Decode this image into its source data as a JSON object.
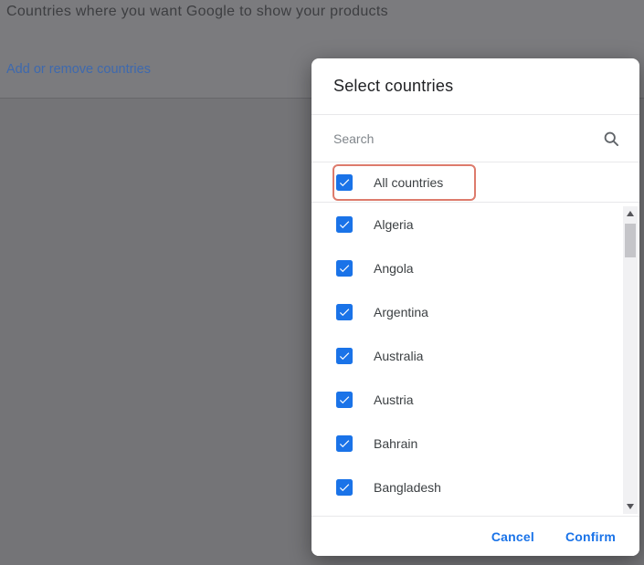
{
  "page": {
    "title": "Countries where you want Google to show your products",
    "add_remove_link": "Add or remove countries"
  },
  "modal": {
    "title": "Select countries",
    "search": {
      "placeholder": "Search",
      "value": "",
      "icon": "search-icon"
    },
    "all_countries": {
      "label": "All countries",
      "checked": true,
      "highlighted": true
    },
    "countries": [
      {
        "label": "Algeria",
        "checked": true
      },
      {
        "label": "Angola",
        "checked": true
      },
      {
        "label": "Argentina",
        "checked": true
      },
      {
        "label": "Australia",
        "checked": true
      },
      {
        "label": "Austria",
        "checked": true
      },
      {
        "label": "Bahrain",
        "checked": true
      },
      {
        "label": "Bangladesh",
        "checked": true
      }
    ],
    "scrollbar": {
      "up_icon": "scrollbar-up-icon",
      "down_icon": "scrollbar-down-icon"
    },
    "footer": {
      "cancel_label": "Cancel",
      "confirm_label": "Confirm"
    }
  },
  "colors": {
    "checkbox_blue": "#1a73e8",
    "button_blue": "#1a73e8",
    "highlight_red": "#dd7b6c",
    "backdrop_gray": "#757578",
    "text_dark": "#202124",
    "text_gray": "#3c4043",
    "placeholder_gray": "#80868b"
  }
}
